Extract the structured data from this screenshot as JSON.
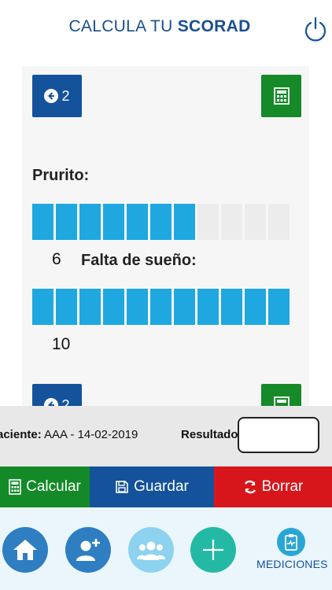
{
  "header": {
    "title_regular": "CALCULA TU ",
    "title_bold": "SCORAD",
    "power_icon": "power-icon"
  },
  "card": {
    "back_button_label": "2",
    "bottom_back_button_label": "2",
    "calculator_icon": "calculator-icon",
    "items": [
      {
        "label": "Prurito:",
        "value": "6",
        "level": 6,
        "max": 11
      },
      {
        "label": "Falta de sueño:",
        "value": "10",
        "level": 11,
        "max": 11
      }
    ]
  },
  "patient": {
    "prefix": "aciente:",
    "value": "AAA - 14-02-2019",
    "result_label": "Resultado:",
    "result_value": ""
  },
  "actions": {
    "calculate": "Calcular",
    "save": "Guardar",
    "clear": "Borrar"
  },
  "bottom_nav": {
    "measurements_label": "MEDICIONES"
  },
  "colors": {
    "primary_blue": "#14539b",
    "green": "#138a27",
    "red": "#d7161b",
    "bar_active": "#1fa8e0",
    "bar_inactive": "#ececec"
  }
}
